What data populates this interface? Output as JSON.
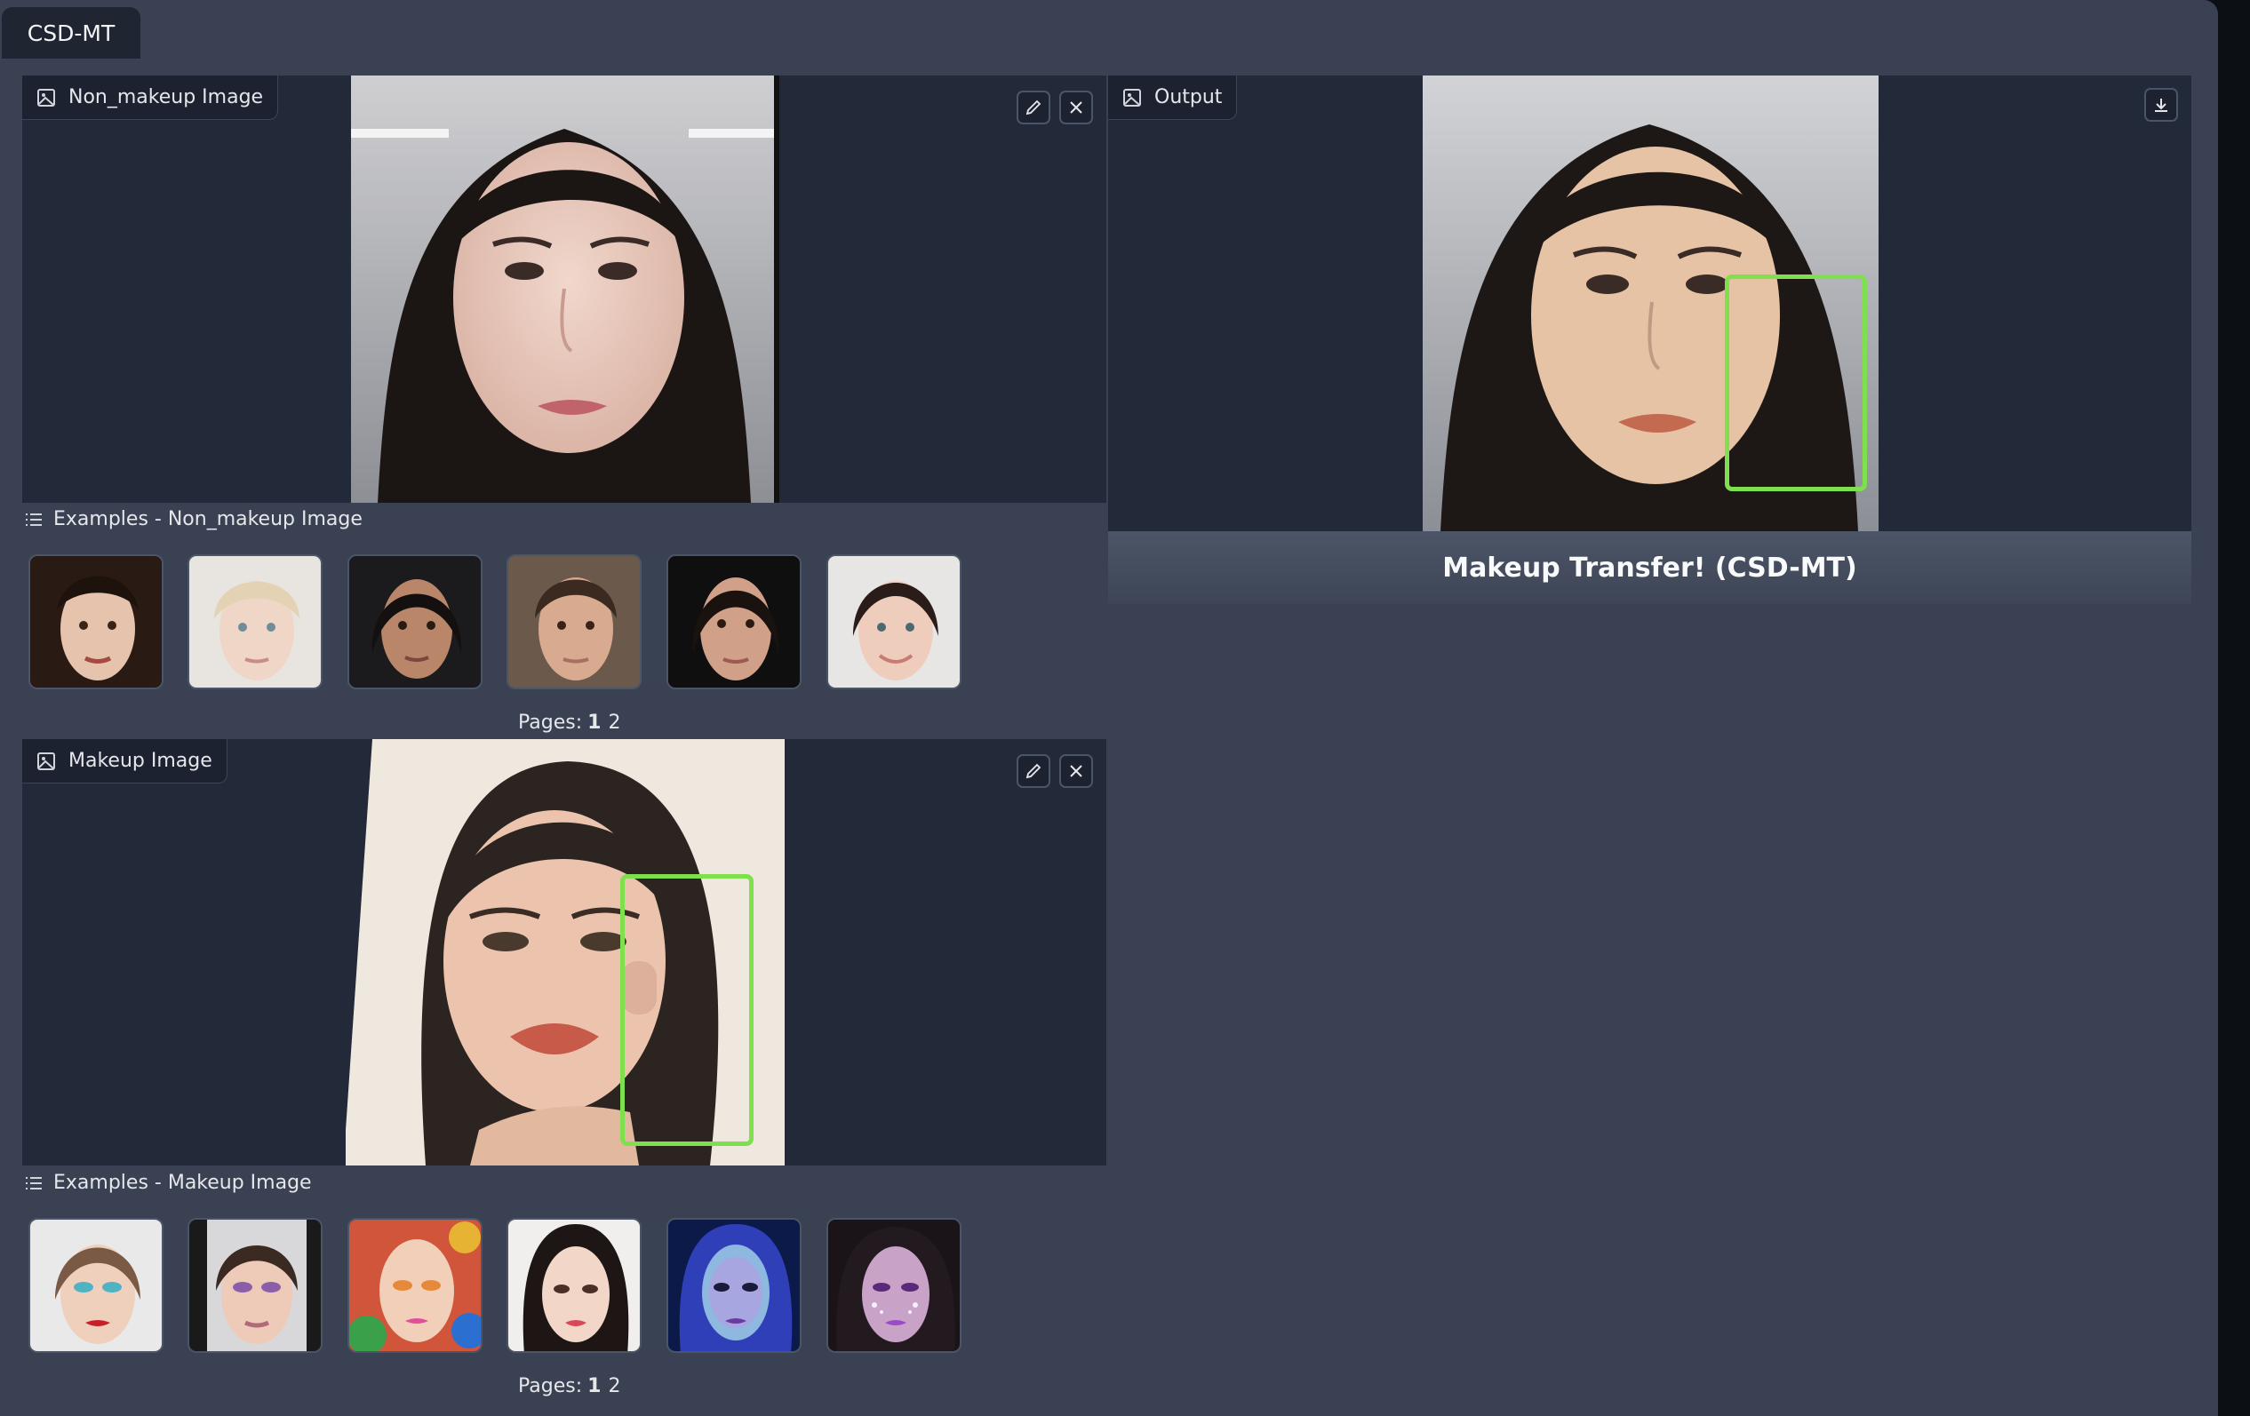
{
  "app": {
    "tab_label": "CSD-MT",
    "accent_color": "#7ee04c",
    "panel_bg": "#222938",
    "app_bg": "#394152"
  },
  "non_makeup": {
    "label": "Non_makeup Image",
    "label_icon": "image-icon",
    "edit_icon": "pencil-icon",
    "clear_icon": "close-icon"
  },
  "non_makeup_examples": {
    "header": "Examples - Non_makeup Image",
    "header_icon": "list-icon",
    "pages_label": "Pages:",
    "pages": [
      "1",
      "2"
    ],
    "current_page": "1"
  },
  "makeup": {
    "label": "Makeup Image",
    "label_icon": "image-icon",
    "edit_icon": "pencil-icon",
    "clear_icon": "close-icon"
  },
  "makeup_examples": {
    "header": "Examples - Makeup Image",
    "header_icon": "list-icon",
    "pages_label": "Pages:",
    "pages": [
      "1",
      "2"
    ],
    "current_page": "1"
  },
  "output": {
    "label": "Output",
    "label_icon": "image-icon",
    "download_icon": "download-icon"
  },
  "submit": {
    "label": "Makeup Transfer! (CSD-MT)"
  }
}
